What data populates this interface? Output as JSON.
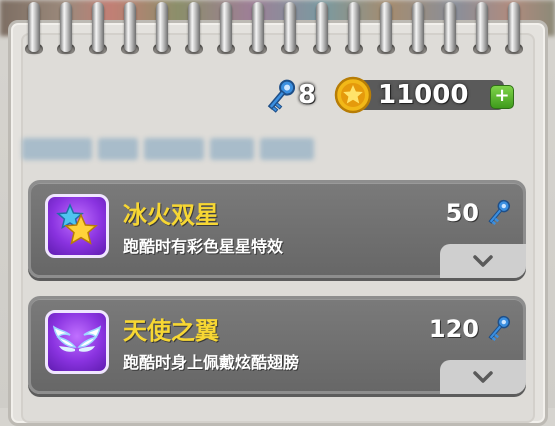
{
  "currency": {
    "keys": "8",
    "coins": "11000",
    "add_label": "+",
    "key_icon": "key-icon",
    "coin_icon": "star-coin-icon"
  },
  "store_items": [
    {
      "title": "冰火双星",
      "description": "跑酷时有彩色星星特效",
      "price": "50",
      "icon": "twin-star-icon",
      "price_icon": "key-icon"
    },
    {
      "title": "天使之翼",
      "description": "跑酷时身上佩戴炫酷翅膀",
      "price": "120",
      "icon": "angel-wings-icon",
      "price_icon": "key-icon"
    }
  ],
  "colors": {
    "title_yellow": "#f7d733",
    "card_gray": "#6f6f6f",
    "icon_purple": "#8a33e0",
    "key_blue": "#3b8fe0",
    "coin_gold": "#f2b818",
    "add_green": "#4fb02a"
  }
}
